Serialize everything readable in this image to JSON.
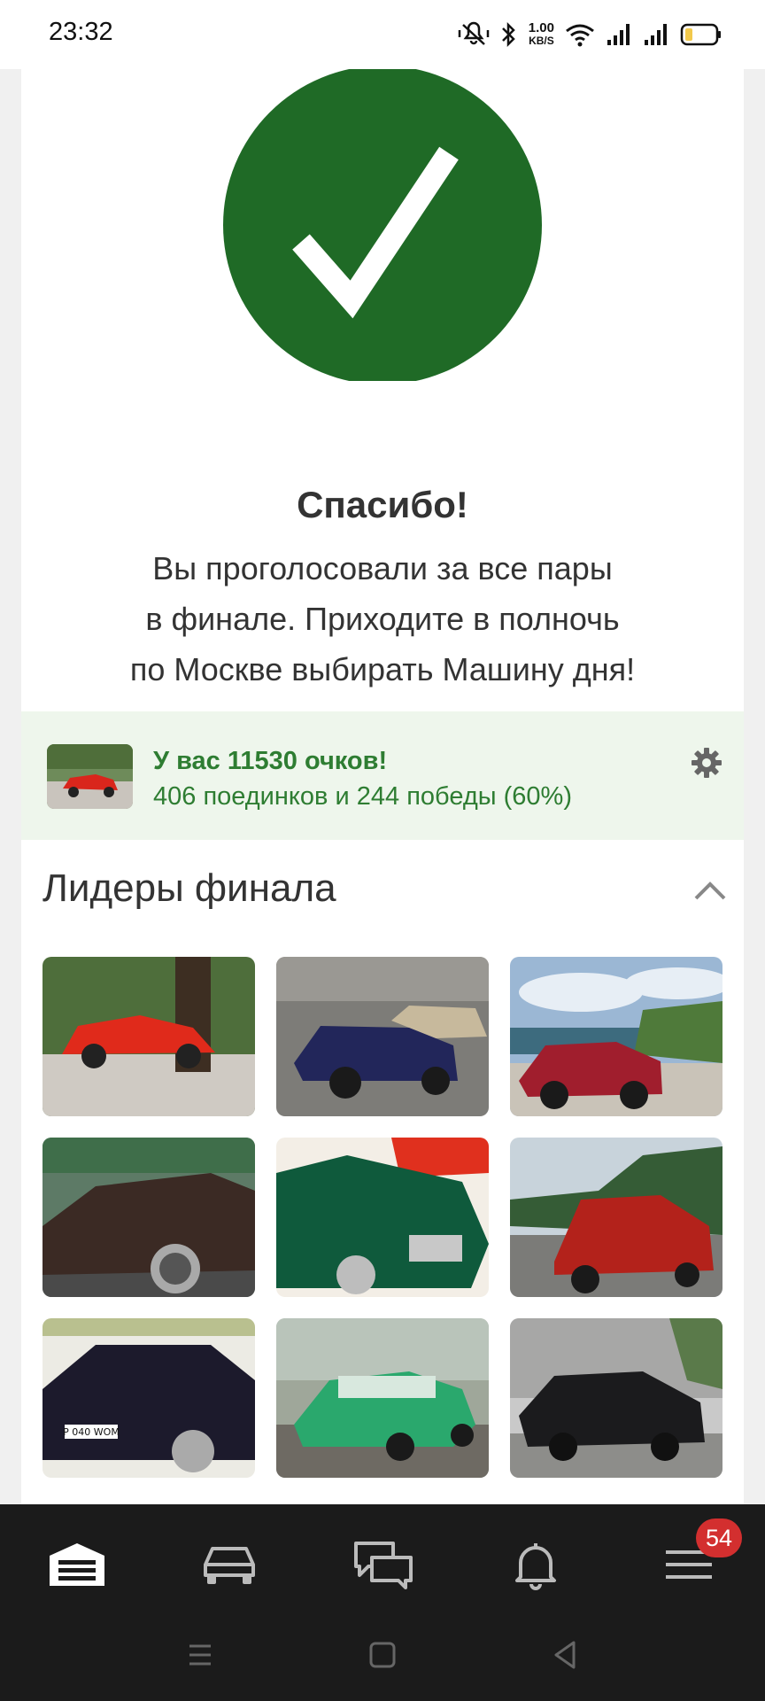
{
  "status_bar": {
    "time": "23:32",
    "net_speed_value": "1.00",
    "net_speed_unit": "KB/S",
    "icons": [
      "mute-vibrate-icon",
      "bluetooth-icon",
      "wifi-icon",
      "signal-icon",
      "signal-icon",
      "battery-icon"
    ]
  },
  "result": {
    "icon": "checkmark-icon",
    "title": "Спасибо!",
    "lines": [
      "Вы проголосовали за все пары",
      "в финале. Приходите в полночь",
      "по Москве выбирать Машину дня!"
    ]
  },
  "score": {
    "headline": "У вас 11530 очков!",
    "stats": "406 поединков и 244 победы (60%)",
    "settings_icon": "gear-icon"
  },
  "leaders": {
    "title": "Лидеры финала",
    "collapse_icon": "chevron-up-icon",
    "cars": [
      {
        "name": "red-coupe"
      },
      {
        "name": "blue-convertible"
      },
      {
        "name": "red-sedan-lake"
      },
      {
        "name": "brown-sedan"
      },
      {
        "name": "green-sedan"
      },
      {
        "name": "red-sports-sedan"
      },
      {
        "name": "black-bmw-sedan"
      },
      {
        "name": "green-vintage-sedan"
      },
      {
        "name": "black-coupe"
      }
    ],
    "plates": {
      "car7": "P 040 WOM"
    }
  },
  "nav": {
    "items": [
      "garage-icon",
      "car-icon",
      "chat-icon",
      "bell-icon",
      "menu-icon"
    ],
    "badge": "54"
  },
  "colors": {
    "accent_green": "#1f6a26",
    "score_bg": "#eef6ec",
    "score_text": "#2e7d32",
    "nav_bg": "#1b1b1b",
    "badge_red": "#d32f2f"
  }
}
